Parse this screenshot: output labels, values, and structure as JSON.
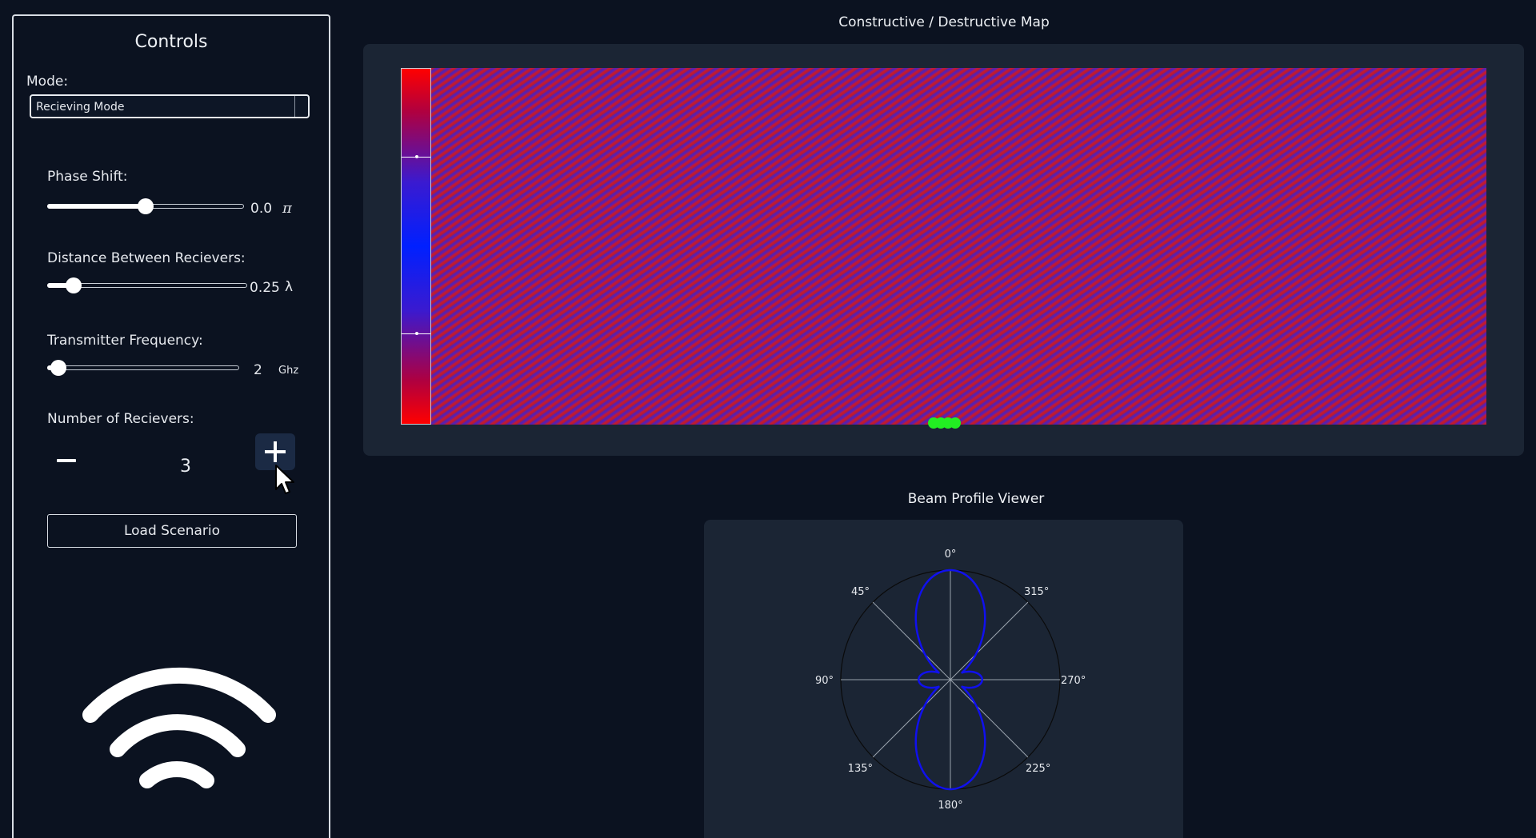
{
  "controls": {
    "title": "Controls",
    "mode_label": "Mode:",
    "mode_value": "Recieving Mode",
    "phase": {
      "label": "Phase Shift:",
      "value": "0.0",
      "unit": "π",
      "fraction": 0.5
    },
    "distance": {
      "label": "Distance Between Recievers:",
      "value": "0.25",
      "unit": "λ",
      "fraction": 0.13
    },
    "frequency": {
      "label": "Transmitter Frequency:",
      "value": "2",
      "unit": "Ghz",
      "fraction": 0.06
    },
    "receivers": {
      "label": "Number of Recievers:",
      "count": "3"
    },
    "load_button": "Load Scenario"
  },
  "map": {
    "title": "Constructive / Destructive Map",
    "receiver_dots": 4
  },
  "beam": {
    "title": "Beam Profile Viewer",
    "angle_labels": {
      "a0": "0°",
      "a45": "45°",
      "a315": "315°",
      "a90": "90°",
      "a270": "270°",
      "a135": "135°",
      "a225": "225°",
      "a180": "180°"
    }
  },
  "colors": {
    "background": "#0b1220",
    "card": "#1b2534",
    "beam_line": "#1010ee",
    "receiver": "#22ee22",
    "accent_button": "#1b2a44"
  },
  "icons": {
    "logo": "wifi-icon",
    "cursor": "cursor-icon",
    "minus": "minus-icon",
    "plus": "plus-icon"
  }
}
